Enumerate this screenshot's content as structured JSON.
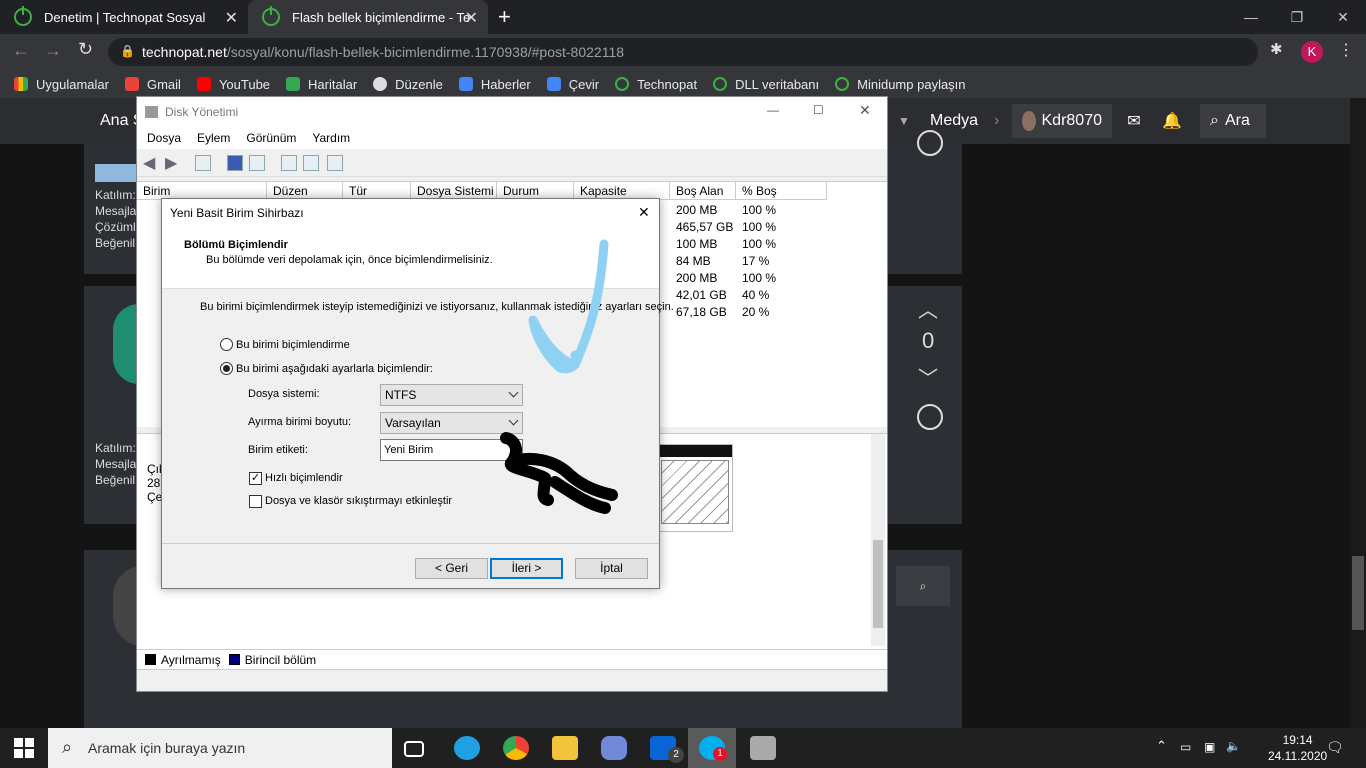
{
  "browser": {
    "tabs": [
      {
        "title": "Denetim | Technopat Sosyal"
      },
      {
        "title": "Flash bellek biçimlendirme - Tech"
      }
    ],
    "url_domain": "technopat.net",
    "url_path": "/sosyal/konu/flash-bellek-bicimlendirme.1170938/#post-8022118",
    "profile_initial": "K",
    "bookmarks": [
      "Uygulamalar",
      "Gmail",
      "YouTube",
      "Haritalar",
      "Düzenle",
      "Haberler",
      "Çevir",
      "Technopat",
      "DLL veritabanı",
      "Minidump paylaşın"
    ]
  },
  "site": {
    "nav_left": "Ana S",
    "medya": "Medya",
    "username": "Kdr8070",
    "search": "Ara",
    "vote_count": "0",
    "side_labels_1": [
      "Katılım:",
      "Mesajla",
      "Çözüml",
      "Beğenil"
    ],
    "side_labels_2": [
      "Katılım:",
      "Mesajla",
      "Beğenil"
    ]
  },
  "disk_mgmt": {
    "title": "Disk Yönetimi",
    "menu": [
      "Dosya",
      "Eylem",
      "Görünüm",
      "Yardım"
    ],
    "columns": [
      "Birim",
      "Düzen",
      "Tür",
      "Dosya Sistemi",
      "Durum",
      "Kapasite",
      "Boş Alan",
      "% Boş"
    ],
    "free_space": [
      "200 MB",
      "465,57 GB",
      "100 MB",
      "84 MB",
      "200 MB",
      "42,01 GB",
      "67,18 GB"
    ],
    "percent_free": [
      "100 %",
      "100 %",
      "100 %",
      "17 %",
      "100 %",
      "40 %",
      "20 %"
    ],
    "lower_fragments": [
      "Çık",
      "28,",
      "Çe"
    ],
    "legend": [
      "Ayrılmamış",
      "Birincil bölüm"
    ]
  },
  "wizard": {
    "window_title": "Yeni Basit Birim Sihirbazı",
    "heading": "Bölümü Biçimlendir",
    "subheading": "Bu bölümde veri depolamak için, önce biçimlendirmelisiniz.",
    "instruction": "Bu birimi biçimlendirmek isteyip istemediğinizi ve istiyorsanız, kullanmak istediğiniz ayarları seçin.",
    "option_no_format": "Bu birimi biçimlendirme",
    "option_format": "Bu birimi aşağıdaki ayarlarla biçimlendir:",
    "fs_label": "Dosya sistemi:",
    "fs_value": "NTFS",
    "alloc_label": "Ayırma birimi boyutu:",
    "alloc_value": "Varsayılan",
    "vol_label": "Birim etiketi:",
    "vol_value": "Yeni Birim",
    "quick_format": "Hızlı biçimlendir",
    "compression": "Dosya ve klasör sıkıştırmayı etkinleştir",
    "back": "< Geri",
    "next": "İleri >",
    "cancel": "İptal"
  },
  "taskbar": {
    "search_placeholder": "Aramak için buraya yazın",
    "time": "19:14",
    "date": "24.11.2020",
    "mail_badge": "2",
    "skype_badge": "1"
  }
}
